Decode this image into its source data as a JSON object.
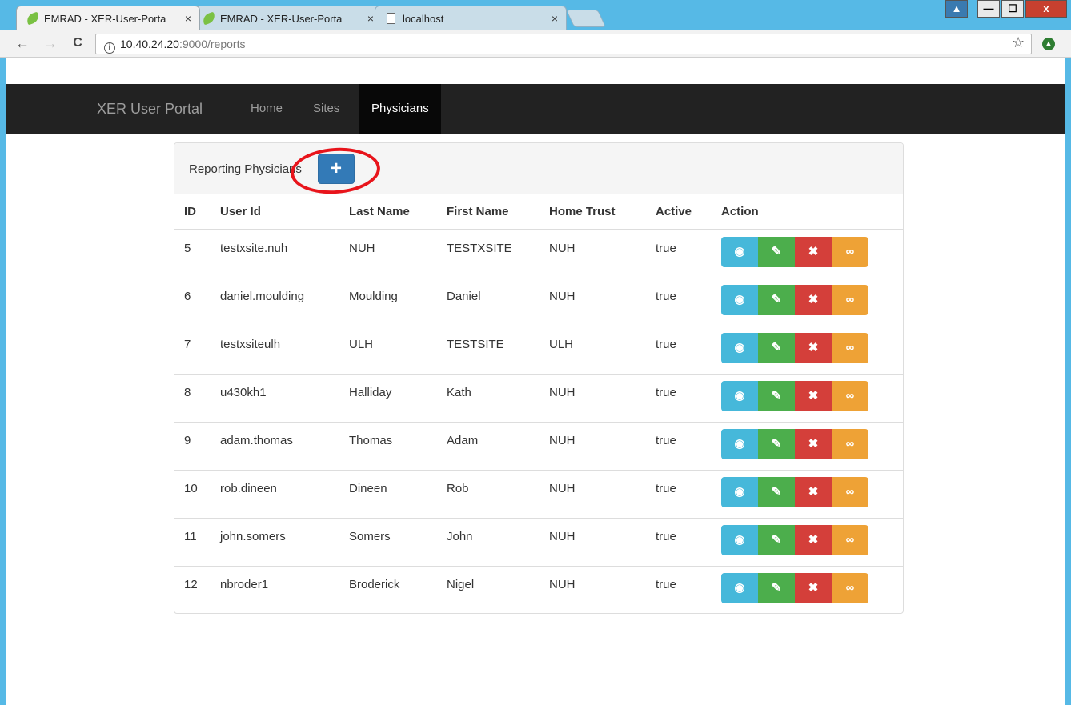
{
  "browser": {
    "tabs": [
      {
        "title": "EMRAD - XER-User-Porta",
        "close": "×",
        "active": true,
        "favicon": "leaf-icon"
      },
      {
        "title": "EMRAD - XER-User-Porta",
        "close": "×",
        "active": false,
        "favicon": "leaf-icon"
      },
      {
        "title": "localhost",
        "close": "×",
        "active": false,
        "favicon": "page-icon"
      }
    ],
    "url_host": "10.40.24.20",
    "url_path": ":9000/reports",
    "info_glyph": "i",
    "back_glyph": "←",
    "forward_glyph": "→",
    "reload_glyph": "C",
    "star_glyph": "☆",
    "ext_glyph": "▲",
    "window_controls": {
      "user": "▲",
      "minimize": "—",
      "maximize": "☐",
      "close": "x"
    }
  },
  "navbar": {
    "brand": "XER User Portal",
    "items": [
      {
        "label": "Home",
        "active": false
      },
      {
        "label": "Sites",
        "active": false
      },
      {
        "label": "Physicians",
        "active": true
      }
    ]
  },
  "panel": {
    "title": "Reporting Physicians",
    "add_glyph": "+"
  },
  "table": {
    "headers": [
      "ID",
      "User Id",
      "Last Name",
      "First Name",
      "Home Trust",
      "Active",
      "Action"
    ],
    "rows": [
      [
        "5",
        "testxsite.nuh",
        "NUH",
        "TESTXSITE",
        "NUH",
        "true"
      ],
      [
        "6",
        "daniel.moulding",
        "Moulding",
        "Daniel",
        "NUH",
        "true"
      ],
      [
        "7",
        "testxsiteulh",
        "ULH",
        "TESTSITE",
        "ULH",
        "true"
      ],
      [
        "8",
        "u430kh1",
        "Halliday",
        "Kath",
        "NUH",
        "true"
      ],
      [
        "9",
        "adam.thomas",
        "Thomas",
        "Adam",
        "NUH",
        "true"
      ],
      [
        "10",
        "rob.dineen",
        "Dineen",
        "Rob",
        "NUH",
        "true"
      ],
      [
        "11",
        "john.somers",
        "Somers",
        "John",
        "NUH",
        "true"
      ],
      [
        "12",
        "nbroder1",
        "Broderick",
        "Nigel",
        "NUH",
        "true"
      ]
    ],
    "action_glyphs": {
      "view": "◉",
      "edit": "✎",
      "delete": "✖",
      "link": "∞"
    },
    "action_icons": [
      "eye-icon",
      "edit-icon",
      "times-icon",
      "link-icon"
    ]
  },
  "colors": {
    "primary": "#337ab7",
    "info": "#46b8da",
    "success": "#4cae4c",
    "danger": "#d43f3a",
    "warning": "#eea236",
    "navbar": "#222222",
    "highlight_ring": "#e8141b"
  }
}
